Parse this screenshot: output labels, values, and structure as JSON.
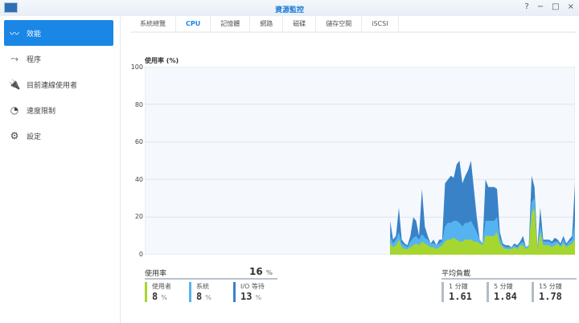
{
  "window": {
    "title": "資源監控",
    "buttons": [
      "?",
      "−",
      "□",
      "×"
    ]
  },
  "sidebar": {
    "items": [
      {
        "label": "效能",
        "icon": "performance-icon",
        "active": true
      },
      {
        "label": "程序",
        "icon": "process-icon"
      },
      {
        "label": "目前連線使用者",
        "icon": "plug-icon"
      },
      {
        "label": "速度限制",
        "icon": "speedometer-icon"
      },
      {
        "label": "設定",
        "icon": "gear-icon"
      }
    ]
  },
  "tabs": [
    {
      "label": "系統總覽"
    },
    {
      "label": "CPU",
      "active": true
    },
    {
      "label": "記憶體"
    },
    {
      "label": "網路"
    },
    {
      "label": "磁碟"
    },
    {
      "label": "儲存空間"
    },
    {
      "label": "iSCSI"
    }
  ],
  "colors": {
    "user": "#a6d630",
    "system": "#55b4f0",
    "io": "#3a82c8",
    "accent": "#1a86e6"
  },
  "chart_data": {
    "type": "area",
    "title": "使用率 (%)",
    "ylabel": "使用率 (%)",
    "ylim": [
      0,
      100
    ],
    "yticks": [
      "100",
      "80",
      "60",
      "40",
      "20",
      "0"
    ],
    "points_total": 150,
    "series": [
      {
        "name": "使用者",
        "values": [
          6,
          4,
          5,
          8,
          4,
          3,
          3,
          4,
          5,
          6,
          5,
          7,
          6,
          5,
          4,
          4,
          3,
          4,
          5,
          7,
          8,
          8,
          9,
          8,
          7,
          7,
          8,
          8,
          8,
          7,
          7,
          6,
          5,
          10,
          10,
          10,
          10,
          12,
          6,
          4,
          3,
          3,
          3,
          4,
          3,
          5,
          5,
          3,
          4,
          22,
          25,
          3,
          12,
          5,
          5,
          5,
          4,
          5,
          6,
          4,
          6,
          4,
          5,
          6,
          8
        ]
      },
      {
        "name": "系統",
        "values": [
          4,
          2,
          3,
          4,
          2,
          2,
          1,
          3,
          4,
          4,
          3,
          4,
          3,
          3,
          2,
          2,
          2,
          2,
          2,
          8,
          9,
          9,
          9,
          10,
          10,
          8,
          9,
          9,
          10,
          8,
          5,
          2,
          1,
          8,
          8,
          8,
          8,
          8,
          3,
          1,
          1,
          1,
          1,
          1,
          1,
          1,
          2,
          1,
          1,
          6,
          5,
          1,
          4,
          2,
          2,
          2,
          2,
          2,
          1,
          1,
          2,
          1,
          2,
          2,
          10
        ]
      },
      {
        "name": "I/O 等待",
        "values": [
          8,
          2,
          2,
          13,
          2,
          1,
          1,
          3,
          11,
          8,
          2,
          24,
          6,
          2,
          0,
          2,
          0,
          2,
          1,
          23,
          23,
          25,
          23,
          30,
          33,
          23,
          25,
          28,
          32,
          20,
          8,
          0,
          0,
          22,
          18,
          18,
          18,
          15,
          3,
          1,
          1,
          1,
          0,
          1,
          1,
          1,
          3,
          0,
          0,
          14,
          6,
          0,
          9,
          1,
          1,
          1,
          1,
          2,
          1,
          1,
          2,
          1,
          1,
          2,
          20
        ]
      }
    ]
  },
  "usage": {
    "title": "使用率",
    "total": "16",
    "unit": "%",
    "items": [
      {
        "label": "使用者",
        "value": "8",
        "unit": "%"
      },
      {
        "label": "系統",
        "value": "8",
        "unit": "%"
      },
      {
        "label": "I/O 等待",
        "value": "13",
        "unit": "%"
      }
    ]
  },
  "load": {
    "title": "平均負載",
    "items": [
      {
        "label": "1 分鐘",
        "value": "1.61"
      },
      {
        "label": "5 分鐘",
        "value": "1.84"
      },
      {
        "label": "15 分鐘",
        "value": "1.78"
      }
    ]
  }
}
